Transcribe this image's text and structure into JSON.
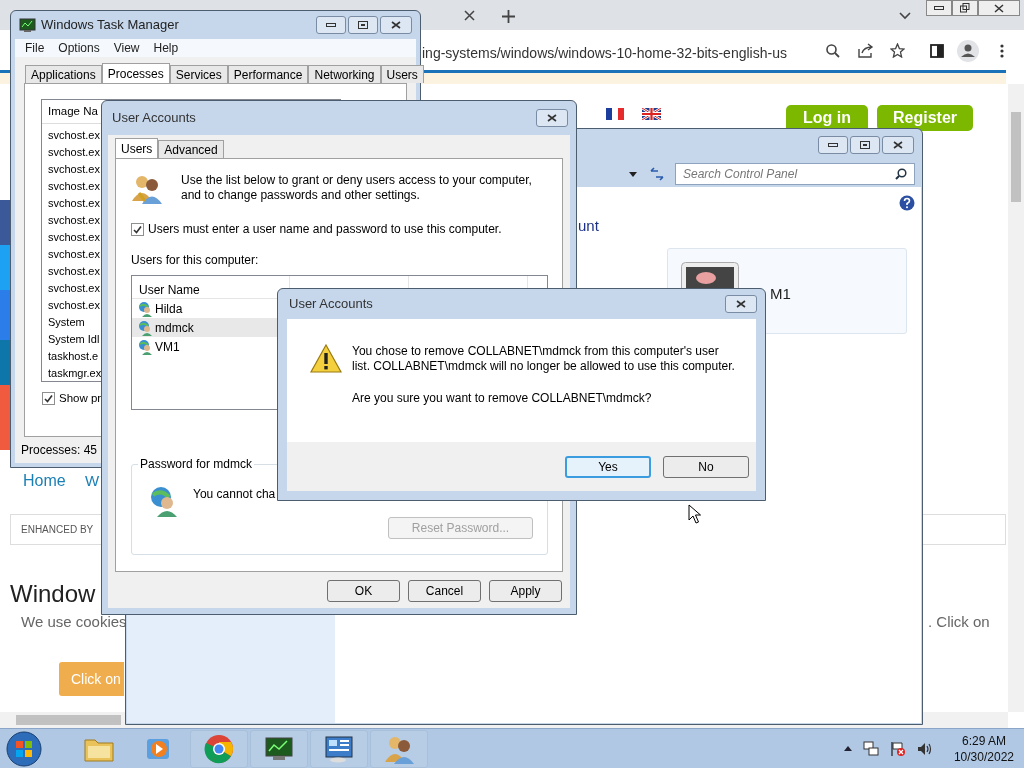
{
  "browser": {
    "url": "ing-systems/windows/windows-10-home-32-bits-english-us",
    "login_button": "Log in",
    "register_button": "Register",
    "nav": [
      "Home",
      "W"
    ],
    "search_label": "ENHANCED BY",
    "heading": "Window",
    "cookie_text": "We use cookies",
    "cookie_text_end": ". Click on",
    "cookie_button": "Click on"
  },
  "control_panel": {
    "search_placeholder": "Search Control Panel",
    "heading": "unt",
    "account_name": "M1"
  },
  "task_manager": {
    "title": "Windows Task Manager",
    "menu": [
      "File",
      "Options",
      "View",
      "Help"
    ],
    "tabs": [
      {
        "label": "Applications",
        "selected": false
      },
      {
        "label": "Processes",
        "selected": true
      },
      {
        "label": "Services",
        "selected": false
      },
      {
        "label": "Performance",
        "selected": false
      },
      {
        "label": "Networking",
        "selected": false
      },
      {
        "label": "Users",
        "selected": false
      }
    ],
    "column": "Image Na",
    "processes": [
      "svchost.ex",
      "svchost.ex",
      "svchost.ex",
      "svchost.ex",
      "svchost.ex",
      "svchost.ex",
      "svchost.ex",
      "svchost.ex",
      "svchost.ex",
      "svchost.ex",
      "svchost.ex",
      "System",
      "System Idl",
      "taskhost.e",
      "taskmgr.ex"
    ],
    "show_all": {
      "label": "Show pr",
      "checked": true
    },
    "status": "Processes: 45"
  },
  "user_accounts": {
    "title": "User Accounts",
    "tabs": [
      {
        "label": "Users",
        "selected": true
      },
      {
        "label": "Advanced",
        "selected": false
      }
    ],
    "intro": "Use the list below to grant or deny users access to your computer, and to change passwords and other settings.",
    "require_login": {
      "label": "Users must enter a user name and password to use this computer.",
      "checked": true
    },
    "list_label": "Users for this computer:",
    "columns": [
      "User Name"
    ],
    "users": [
      {
        "name": "Hilda",
        "selected": false
      },
      {
        "name": "mdmck",
        "selected": true
      },
      {
        "name": "VM1",
        "selected": false
      }
    ],
    "password_group": "Password for mdmck",
    "password_note": "You cannot cha",
    "reset_button": {
      "label": "Reset Password...",
      "disabled": true
    },
    "buttons": [
      "OK",
      "Cancel",
      "Apply"
    ]
  },
  "confirm": {
    "title": "User Accounts",
    "message": "You chose to remove COLLABNET\\mdmck from this computer's user list. COLLABNET\\mdmck will no longer be allowed to use this computer.",
    "question": "Are you sure you want to remove COLLABNET\\mdmck?",
    "buttons": [
      {
        "label": "Yes",
        "default": true
      },
      {
        "label": "No",
        "default": false
      }
    ]
  },
  "taskbar": {
    "time": "6:29 AM",
    "date": "10/30/2022"
  }
}
